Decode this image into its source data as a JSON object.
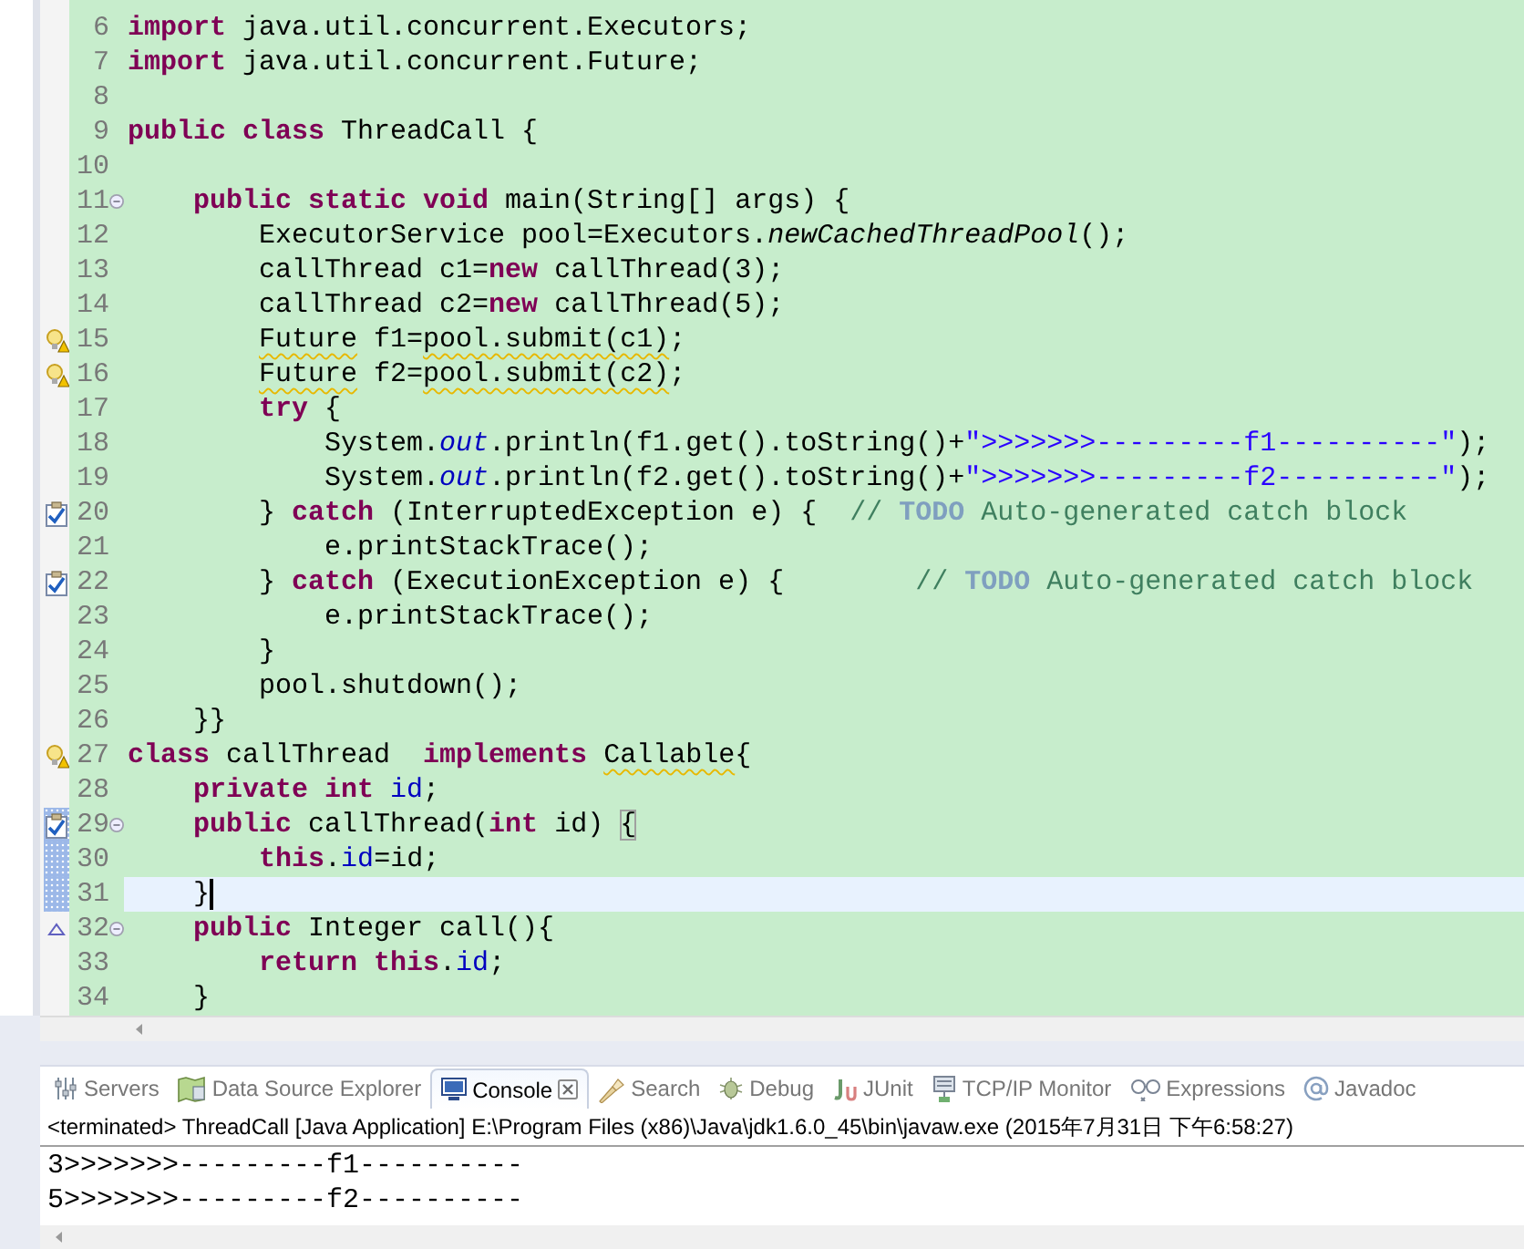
{
  "editor": {
    "lines": [
      {
        "number": "6",
        "kind": "plain",
        "fold": false,
        "changed": false,
        "current": false,
        "tokens": [
          {
            "kind": "keyword",
            "text": "import"
          },
          {
            "kind": "plain",
            "text": " java.util.concurrent.Executors;"
          }
        ]
      },
      {
        "number": "7",
        "kind": "plain",
        "fold": false,
        "changed": false,
        "current": false,
        "tokens": [
          {
            "kind": "keyword",
            "text": "import"
          },
          {
            "kind": "plain",
            "text": " java.util.concurrent.Future;"
          }
        ]
      },
      {
        "number": "8",
        "kind": "plain",
        "fold": false,
        "changed": false,
        "current": false
      },
      {
        "number": "9",
        "kind": "plain",
        "fold": false,
        "changed": false,
        "current": false,
        "tokens": [
          {
            "kind": "keyword",
            "text": "public class"
          },
          {
            "kind": "plain",
            "text": " ThreadCall {"
          }
        ]
      },
      {
        "number": "10",
        "kind": "plain",
        "fold": false,
        "changed": false,
        "current": false
      },
      {
        "number": "11",
        "kind": "plain",
        "fold": true,
        "changed": false,
        "current": false,
        "tokens": [
          {
            "kind": "keyword",
            "text": "    public static void"
          },
          {
            "kind": "plain",
            "text": " main(String[] args) {"
          }
        ]
      },
      {
        "number": "12",
        "kind": "plain",
        "fold": false,
        "changed": false,
        "current": false,
        "tokens": [
          {
            "kind": "plain",
            "text": "        ExecutorService pool=Executors."
          },
          {
            "kind": "static-method",
            "text": "newCachedThreadPool"
          },
          {
            "kind": "plain",
            "text": "();"
          }
        ]
      },
      {
        "number": "13",
        "kind": "plain",
        "fold": false,
        "changed": false,
        "current": false,
        "tokens": [
          {
            "kind": "plain",
            "text": "        callThread c1="
          },
          {
            "kind": "keyword",
            "text": "new"
          },
          {
            "kind": "plain",
            "text": " callThread(3);"
          }
        ]
      },
      {
        "number": "14",
        "kind": "plain",
        "fold": false,
        "changed": false,
        "current": false,
        "tokens": [
          {
            "kind": "plain",
            "text": "        callThread c2="
          },
          {
            "kind": "keyword",
            "text": "new"
          },
          {
            "kind": "plain",
            "text": " callThread(5);"
          }
        ]
      },
      {
        "number": "15",
        "kind": "warning",
        "fold": false,
        "changed": false,
        "current": false,
        "tokens": [
          {
            "kind": "warning",
            "text": "        Future"
          },
          {
            "kind": "plain",
            "text": " f1="
          },
          {
            "kind": "warning",
            "text": "pool.submit(c1)"
          },
          {
            "kind": "plain",
            "text": ";"
          }
        ]
      },
      {
        "number": "16",
        "kind": "warning",
        "fold": false,
        "changed": false,
        "current": false,
        "tokens": [
          {
            "kind": "warning",
            "text": "        Future"
          },
          {
            "kind": "plain",
            "text": " f2="
          },
          {
            "kind": "warning",
            "text": "pool.submit(c2)"
          },
          {
            "kind": "plain",
            "text": ";"
          }
        ]
      },
      {
        "number": "17",
        "kind": "plain",
        "fold": false,
        "changed": false,
        "current": false,
        "tokens": [
          {
            "kind": "keyword",
            "text": "        try"
          },
          {
            "kind": "plain",
            "text": " {"
          }
        ]
      },
      {
        "number": "18",
        "kind": "plain",
        "fold": false,
        "changed": false,
        "current": false,
        "tokens": [
          {
            "kind": "plain",
            "text": "            System."
          },
          {
            "kind": "static-field",
            "text": "out"
          },
          {
            "kind": "plain",
            "text": ".println(f1.get().toString()+"
          },
          {
            "kind": "string",
            "text": "\">>>>>>>---------f1----------\""
          },
          {
            "kind": "plain",
            "text": ");"
          }
        ]
      },
      {
        "number": "19",
        "kind": "plain",
        "fold": false,
        "changed": false,
        "current": false,
        "tokens": [
          {
            "kind": "plain",
            "text": "            System."
          },
          {
            "kind": "static-field",
            "text": "out"
          },
          {
            "kind": "plain",
            "text": ".println(f2.get().toString()+"
          },
          {
            "kind": "string",
            "text": "\">>>>>>>---------f2----------\""
          },
          {
            "kind": "plain",
            "text": ");"
          }
        ]
      },
      {
        "number": "20",
        "kind": "task",
        "fold": false,
        "changed": false,
        "current": false,
        "tokens": [
          {
            "kind": "plain",
            "text": "        } "
          },
          {
            "kind": "keyword",
            "text": "catch"
          },
          {
            "kind": "plain",
            "text": " (InterruptedException e) {  "
          },
          {
            "kind": "comment",
            "text": "// "
          },
          {
            "kind": "todo",
            "text": "TODO"
          },
          {
            "kind": "comment",
            "text": " Auto-generated catch block"
          }
        ]
      },
      {
        "number": "21",
        "kind": "plain",
        "fold": false,
        "changed": false,
        "current": false,
        "tokens": [
          {
            "kind": "plain",
            "text": "            e.printStackTrace();"
          }
        ]
      },
      {
        "number": "22",
        "kind": "task",
        "fold": false,
        "changed": false,
        "current": false,
        "tokens": [
          {
            "kind": "plain",
            "text": "        } "
          },
          {
            "kind": "keyword",
            "text": "catch"
          },
          {
            "kind": "plain",
            "text": " (ExecutionException e) {        "
          },
          {
            "kind": "comment",
            "text": "// "
          },
          {
            "kind": "todo",
            "text": "TODO"
          },
          {
            "kind": "comment",
            "text": " Auto-generated catch block"
          }
        ]
      },
      {
        "number": "23",
        "kind": "plain",
        "fold": false,
        "changed": false,
        "current": false,
        "tokens": [
          {
            "kind": "plain",
            "text": "            e.printStackTrace();"
          }
        ]
      },
      {
        "number": "24",
        "kind": "plain",
        "fold": false,
        "changed": false,
        "current": false,
        "tokens": [
          {
            "kind": "plain",
            "text": "        }"
          }
        ]
      },
      {
        "number": "25",
        "kind": "plain",
        "fold": false,
        "changed": false,
        "current": false,
        "tokens": [
          {
            "kind": "plain",
            "text": "        pool.shutdown();"
          }
        ]
      },
      {
        "number": "26",
        "kind": "plain",
        "fold": false,
        "changed": false,
        "current": false,
        "tokens": [
          {
            "kind": "plain",
            "text": "    }}"
          }
        ]
      },
      {
        "number": "27",
        "kind": "warning",
        "fold": false,
        "changed": false,
        "current": false,
        "tokens": [
          {
            "kind": "keyword",
            "text": "class"
          },
          {
            "kind": "plain",
            "text": " callThread  "
          },
          {
            "kind": "keyword",
            "text": "implements"
          },
          {
            "kind": "warning",
            "text": " Callable"
          },
          {
            "kind": "plain",
            "text": "{"
          }
        ]
      },
      {
        "number": "28",
        "kind": "plain",
        "fold": false,
        "changed": false,
        "current": false,
        "tokens": [
          {
            "kind": "keyword",
            "text": "    private int"
          },
          {
            "kind": "field",
            "text": " id"
          },
          {
            "kind": "plain",
            "text": ";"
          }
        ]
      },
      {
        "number": "29",
        "kind": "task",
        "fold": true,
        "changed": true,
        "current": false,
        "tokens": [
          {
            "kind": "keyword",
            "text": "    public"
          },
          {
            "kind": "plain",
            "text": " callThread("
          },
          {
            "kind": "keyword",
            "text": "int"
          },
          {
            "kind": "plain",
            "text": " id) "
          },
          {
            "kind": "bracket",
            "text": "{"
          }
        ]
      },
      {
        "number": "30",
        "kind": "plain",
        "fold": false,
        "changed": true,
        "current": false,
        "tokens": [
          {
            "kind": "keyword",
            "text": "        this"
          },
          {
            "kind": "plain",
            "text": "."
          },
          {
            "kind": "field",
            "text": "id"
          },
          {
            "kind": "plain",
            "text": "=id;"
          }
        ]
      },
      {
        "number": "31",
        "kind": "plain",
        "fold": false,
        "changed": true,
        "current": true,
        "tokens": [
          {
            "kind": "plain",
            "text": "    }"
          }
        ]
      },
      {
        "number": "32",
        "kind": "override",
        "fold": true,
        "changed": false,
        "current": false,
        "tokens": [
          {
            "kind": "keyword",
            "text": "    public"
          },
          {
            "kind": "plain",
            "text": " Integer call(){"
          }
        ]
      },
      {
        "number": "33",
        "kind": "plain",
        "fold": false,
        "changed": false,
        "current": false,
        "tokens": [
          {
            "kind": "keyword",
            "text": "        return this"
          },
          {
            "kind": "plain",
            "text": "."
          },
          {
            "kind": "field",
            "text": "id"
          },
          {
            "kind": "plain",
            "text": ";"
          }
        ]
      },
      {
        "number": "34",
        "kind": "plain",
        "fold": false,
        "changed": false,
        "current": false,
        "tokens": [
          {
            "kind": "plain",
            "text": "    }"
          }
        ]
      }
    ]
  },
  "views": {
    "tabs": [
      {
        "label": "Servers",
        "selected": false
      },
      {
        "label": "Data Source Explorer",
        "selected": false
      },
      {
        "label": "Console",
        "selected": true
      },
      {
        "label": "Search",
        "selected": false
      },
      {
        "label": "Debug",
        "selected": false
      },
      {
        "label": "JUnit",
        "selected": false
      },
      {
        "label": "TCP/IP Monitor",
        "selected": false
      },
      {
        "label": "Expressions",
        "selected": false
      },
      {
        "label": "Javadoc",
        "selected": false
      }
    ],
    "console": {
      "header": "<terminated> ThreadCall [Java Application] E:\\Program Files (x86)\\Java\\jdk1.6.0_45\\bin\\javaw.exe (2015年7月31日 下午6:58:27)",
      "output": [
        "3>>>>>>>---------f1----------",
        "5>>>>>>>---------f2----------"
      ]
    }
  }
}
